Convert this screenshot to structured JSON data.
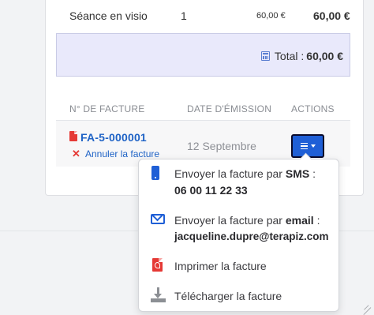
{
  "service_row": {
    "label": "Séance en visio",
    "quantity": "1",
    "unit_price": "60,00 €",
    "amount": "60,00 €"
  },
  "total": {
    "label": "Total :",
    "value": "60,00 €"
  },
  "invoices_table": {
    "headers": [
      "N° DE FACTURE",
      "DATE D'ÉMISSION",
      "ACTIONS"
    ],
    "rows": [
      {
        "number": "FA-5-000001",
        "cancel_label": "Annuler la facture",
        "date": "12 Septembre"
      }
    ]
  },
  "actions_menu": {
    "sms_prefix": "Envoyer la facture par",
    "sms_bold": "SMS",
    "sms_suffix": ":",
    "sms_phone": "06 00 11 22 33",
    "email_prefix": "Envoyer la facture par",
    "email_bold": "email",
    "email_suffix": ":",
    "email_address": "jacqueline.dupre@terapiz.com",
    "print_label": "Imprimer la facture",
    "download_label": "Télécharger la facture"
  },
  "colors": {
    "accent": "#1f5fd6",
    "danger": "#e53935",
    "total_bg": "#e9e9fb"
  }
}
